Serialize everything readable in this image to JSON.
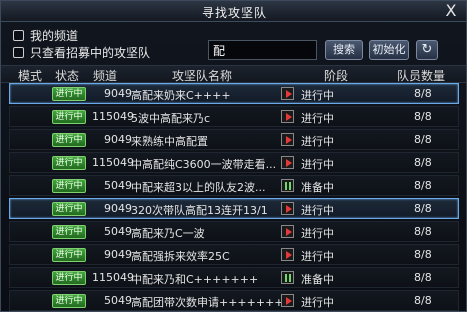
{
  "window": {
    "title": "寻找攻坚队",
    "close_label": "X"
  },
  "filters": {
    "my_channel": "我的频道",
    "recruiting_only": "只查看招募中的攻坚队",
    "search_value": "配",
    "search_button": "搜索",
    "reset_button": "初始化",
    "refresh_symbol": "↻"
  },
  "columns": {
    "mode": "模式",
    "status": "状态",
    "channel": "频道",
    "name": "攻坚队名称",
    "phase": "阶段",
    "members": "队员数量"
  },
  "rows": [
    {
      "status": "进行中",
      "channel": "9049",
      "name": "高配来奶来C++++",
      "phase_icon": "play",
      "phase": "进行中",
      "members": "8/8",
      "selected": true
    },
    {
      "status": "进行中",
      "channel": "115049",
      "name": "5波中高配来乃c",
      "phase_icon": "play",
      "phase": "进行中",
      "members": "8/8",
      "selected": false
    },
    {
      "status": "进行中",
      "channel": "9049",
      "name": "来熟练中高配置",
      "phase_icon": "play",
      "phase": "进行中",
      "members": "8/8",
      "selected": false
    },
    {
      "status": "进行中",
      "channel": "115049",
      "name": "中高配纯C3600一波带走看...",
      "phase_icon": "play",
      "phase": "进行中",
      "members": "8/8",
      "selected": false
    },
    {
      "status": "进行中",
      "channel": "5049",
      "name": "中配来超3以上的队友2波...",
      "phase_icon": "pause",
      "phase": "准备中",
      "members": "8/8",
      "selected": false
    },
    {
      "status": "进行中",
      "channel": "9049",
      "name": "320次带队高配13连开13/1",
      "phase_icon": "play",
      "phase": "进行中",
      "members": "8/8",
      "selected": true
    },
    {
      "status": "进行中",
      "channel": "5049",
      "name": "高配来乃C一波",
      "phase_icon": "play",
      "phase": "进行中",
      "members": "8/8",
      "selected": false
    },
    {
      "status": "进行中",
      "channel": "9049",
      "name": "高配强拆来效率25C",
      "phase_icon": "play",
      "phase": "进行中",
      "members": "8/8",
      "selected": false
    },
    {
      "status": "进行中",
      "channel": "115049",
      "name": "中配来乃和C+++++++",
      "phase_icon": "pause",
      "phase": "准备中",
      "members": "8/8",
      "selected": false
    },
    {
      "status": "进行中",
      "channel": "5049",
      "name": "高配团带次数申请+++++++...",
      "phase_icon": "play",
      "phase": "进行中",
      "members": "8/8",
      "selected": false
    }
  ]
}
